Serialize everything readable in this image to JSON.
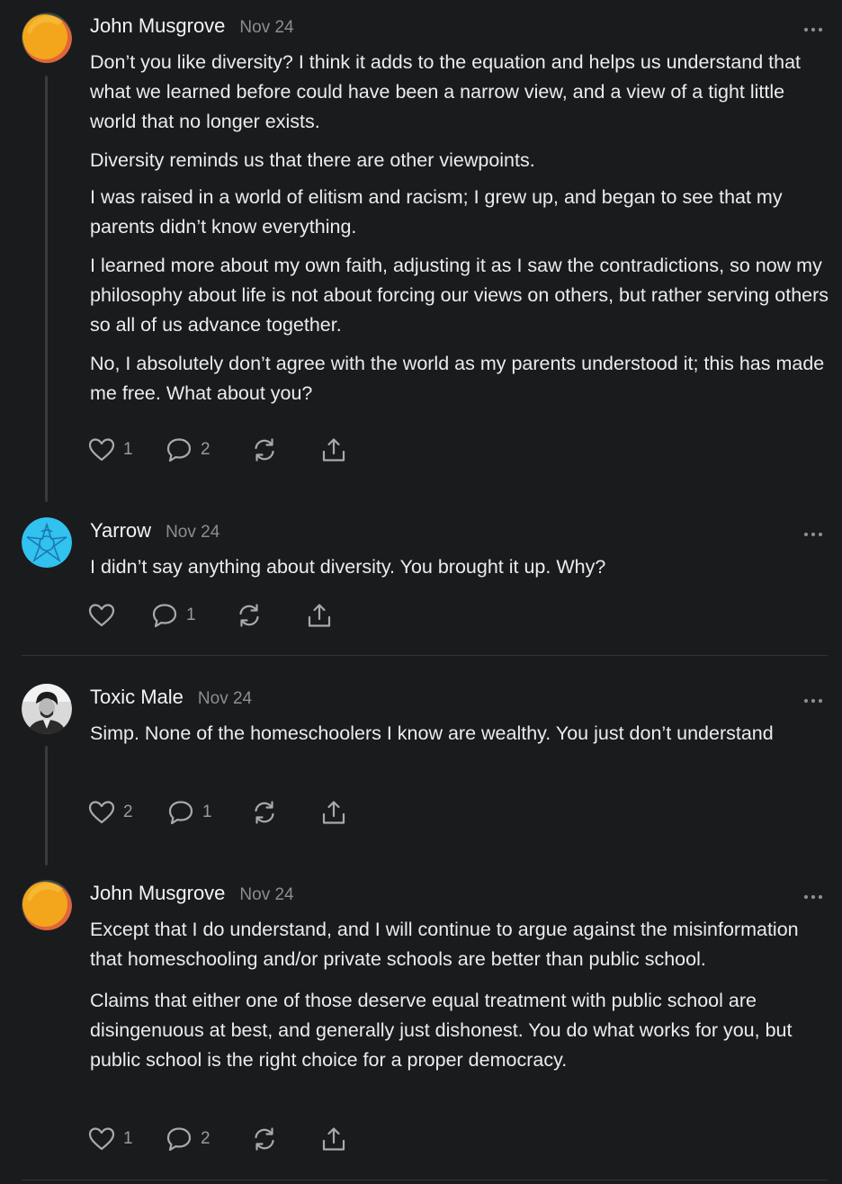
{
  "comments": [
    {
      "author": "John Musgrove",
      "date": "Nov 24",
      "paragraphs": [
        "Don’t you like diversity? I think it adds to the equation and helps us understand that what we learned before could have been a narrow view, and a view of a tight little world that no longer exists.",
        "Diversity reminds us that there are other viewpoints.",
        "I was raised in a world of elitism and racism; I grew up, and began to see that my parents didn’t know everything.",
        "I learned more about my own faith, adjusting it as I saw the contradictions, so now my philosophy about life is not about forcing our views on others, but rather serving others so all of us advance together.",
        "No, I absolutely don’t agree with the world as my parents understood it; this has made me free. What about you?"
      ],
      "likes": "1",
      "replies": "2"
    },
    {
      "author": "Yarrow",
      "date": "Nov 24",
      "paragraphs": [
        "I didn’t say anything about diversity. You brought it up. Why?"
      ],
      "likes": "",
      "replies": "1"
    },
    {
      "author": "Toxic Male",
      "date": "Nov 24",
      "paragraphs": [
        "Simp. None of the homeschoolers I know are wealthy. You just don’t understand"
      ],
      "likes": "2",
      "replies": "1"
    },
    {
      "author": "John Musgrove",
      "date": "Nov 24",
      "paragraphs": [
        "Except that I do understand, and I will continue to argue against the misinformation that homeschooling and/or private schools are better than public school.",
        "Claims that either one of those deserve equal treatment with public school are disingenuous at best, and generally just dishonest. You do what works for you, but public school is the right choice for a proper democracy."
      ],
      "likes": "1",
      "replies": "2"
    }
  ],
  "icons": {
    "like": "heart-icon",
    "reply": "speech-bubble-icon",
    "restack": "restack-icon",
    "share": "share-icon",
    "more": "ellipsis-icon"
  },
  "colors": {
    "background": "#1a1b1d",
    "text": "#ececec",
    "muted": "#8d8d92",
    "icon": "#a9a9ae",
    "thread_line": "#3a3b3e",
    "divider": "#323337"
  }
}
